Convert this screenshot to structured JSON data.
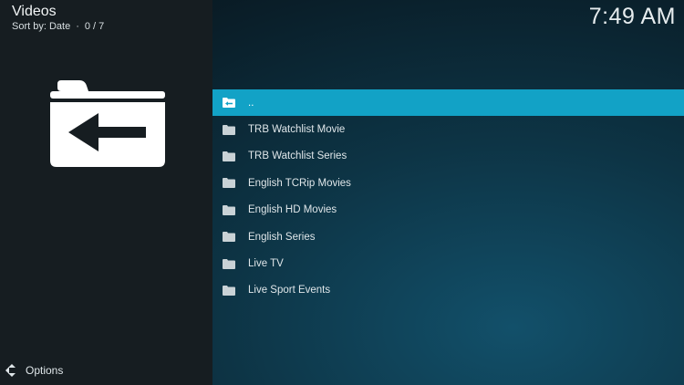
{
  "header": {
    "title": "Videos",
    "sort_label": "Sort by: Date",
    "separator": "·",
    "count": "0 / 7"
  },
  "clock": "7:49 AM",
  "preview_icon": "folder-back-icon",
  "list": {
    "items": [
      {
        "label": "..",
        "icon": "folder-back-icon",
        "selected": true
      },
      {
        "label": "TRB Watchlist Movie",
        "icon": "folder-icon"
      },
      {
        "label": "TRB Watchlist Series",
        "icon": "folder-icon"
      },
      {
        "label": "English TCRip Movies",
        "icon": "folder-icon"
      },
      {
        "label": "English HD Movies",
        "icon": "folder-icon"
      },
      {
        "label": "English Series",
        "icon": "folder-icon"
      },
      {
        "label": "Live TV",
        "icon": "folder-icon"
      },
      {
        "label": "Live Sport Events",
        "icon": "folder-icon"
      }
    ]
  },
  "footer": {
    "options_label": "Options",
    "icon": "options-arrows-icon"
  },
  "colors": {
    "accent": "#12a2c6",
    "left_panel": "#161d21"
  }
}
